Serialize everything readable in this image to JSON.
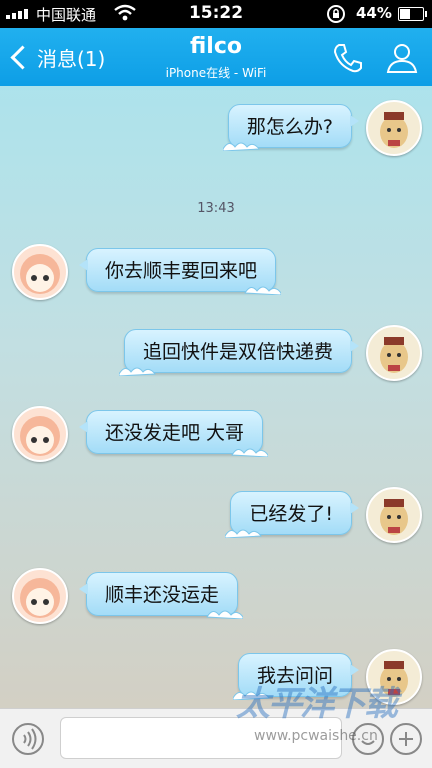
{
  "status_bar": {
    "carrier": "中国联通",
    "time": "15:22",
    "battery": "44%",
    "battery_level": 0.44
  },
  "header": {
    "back_label": "消息(1)",
    "title": "filco",
    "subtitle": "iPhone在线 - WiFi",
    "bar_color": "#12a5ea",
    "phone_icon": "phone-icon",
    "profile_icon": "person-icon"
  },
  "chat": {
    "timestamp": "13:43",
    "messages": [
      {
        "sender": "me",
        "text": "那怎么办?"
      },
      {
        "sender": "other",
        "text": "你去顺丰要回来吧"
      },
      {
        "sender": "me",
        "text": "追回快件是双倍快递费"
      },
      {
        "sender": "other",
        "text": "还没发走吧 大哥"
      },
      {
        "sender": "me",
        "text": "已经发了!"
      },
      {
        "sender": "other",
        "text": "顺丰还没运走"
      },
      {
        "sender": "me",
        "text": "我去问问"
      }
    ]
  },
  "input_bar": {
    "voice_icon": "voice-icon",
    "emoji_icon": "emoji-icon",
    "plus_icon": "plus-icon"
  },
  "watermark": {
    "logo": "太平洋下载",
    "url": "www.pcwaishe.cn"
  }
}
